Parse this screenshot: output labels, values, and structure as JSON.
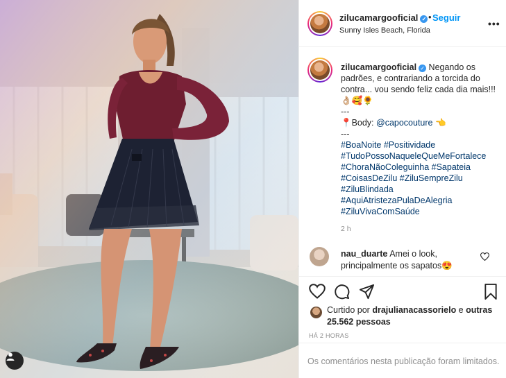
{
  "colors": {
    "accent": "#0095f6",
    "hashtag": "#00376b",
    "muted": "#8e8e8e",
    "verified": "#3897f0"
  },
  "photo": {
    "tag_icon": "user-tag-icon"
  },
  "header": {
    "username": "zilucamargooficial",
    "separator": "•",
    "follow_label": "Seguir",
    "location": "Sunny Isles Beach, Florida",
    "more_icon": "more-options-icon"
  },
  "caption": {
    "username": "zilucamargooficial",
    "lines": [
      "Negando os padrões, e contrariando a torcida do contra... vou sendo feliz cada dia mais!!! 👌🏼🥰🌻",
      "---",
      "📍Body: ",
      "---"
    ],
    "body_mention": "@capocouture",
    "body_emoji": "👈",
    "hashtags": [
      "#BoaNoite #Positividade",
      "#TudoPossoNaqueleQueMeFortalece",
      "#ChoraNãoColeguinha #Sapateia",
      "#CoisasDeZilu #ZiluSempreZilu",
      "#ZiluBlindada",
      "#AquiAtristezaPulaDeAlegria",
      "#ZiluVivaComSaúde"
    ],
    "time": "2 h"
  },
  "comment": {
    "username": "nau_duarte",
    "text": "Amei o look, principalmente os sapatos😍"
  },
  "actions": {
    "like_icon": "heart-icon",
    "comment_icon": "comment-icon",
    "share_icon": "share-icon",
    "save_icon": "bookmark-icon",
    "liked_prefix": "Curtido por ",
    "liked_by": "drajulianacassorielo",
    "liked_middle": " e ",
    "liked_others": "outras 25.562 pessoas",
    "timestamp": "HÁ 2 HORAS"
  },
  "footer": {
    "limited_text": "Os comentários nesta publicação foram limitados."
  }
}
